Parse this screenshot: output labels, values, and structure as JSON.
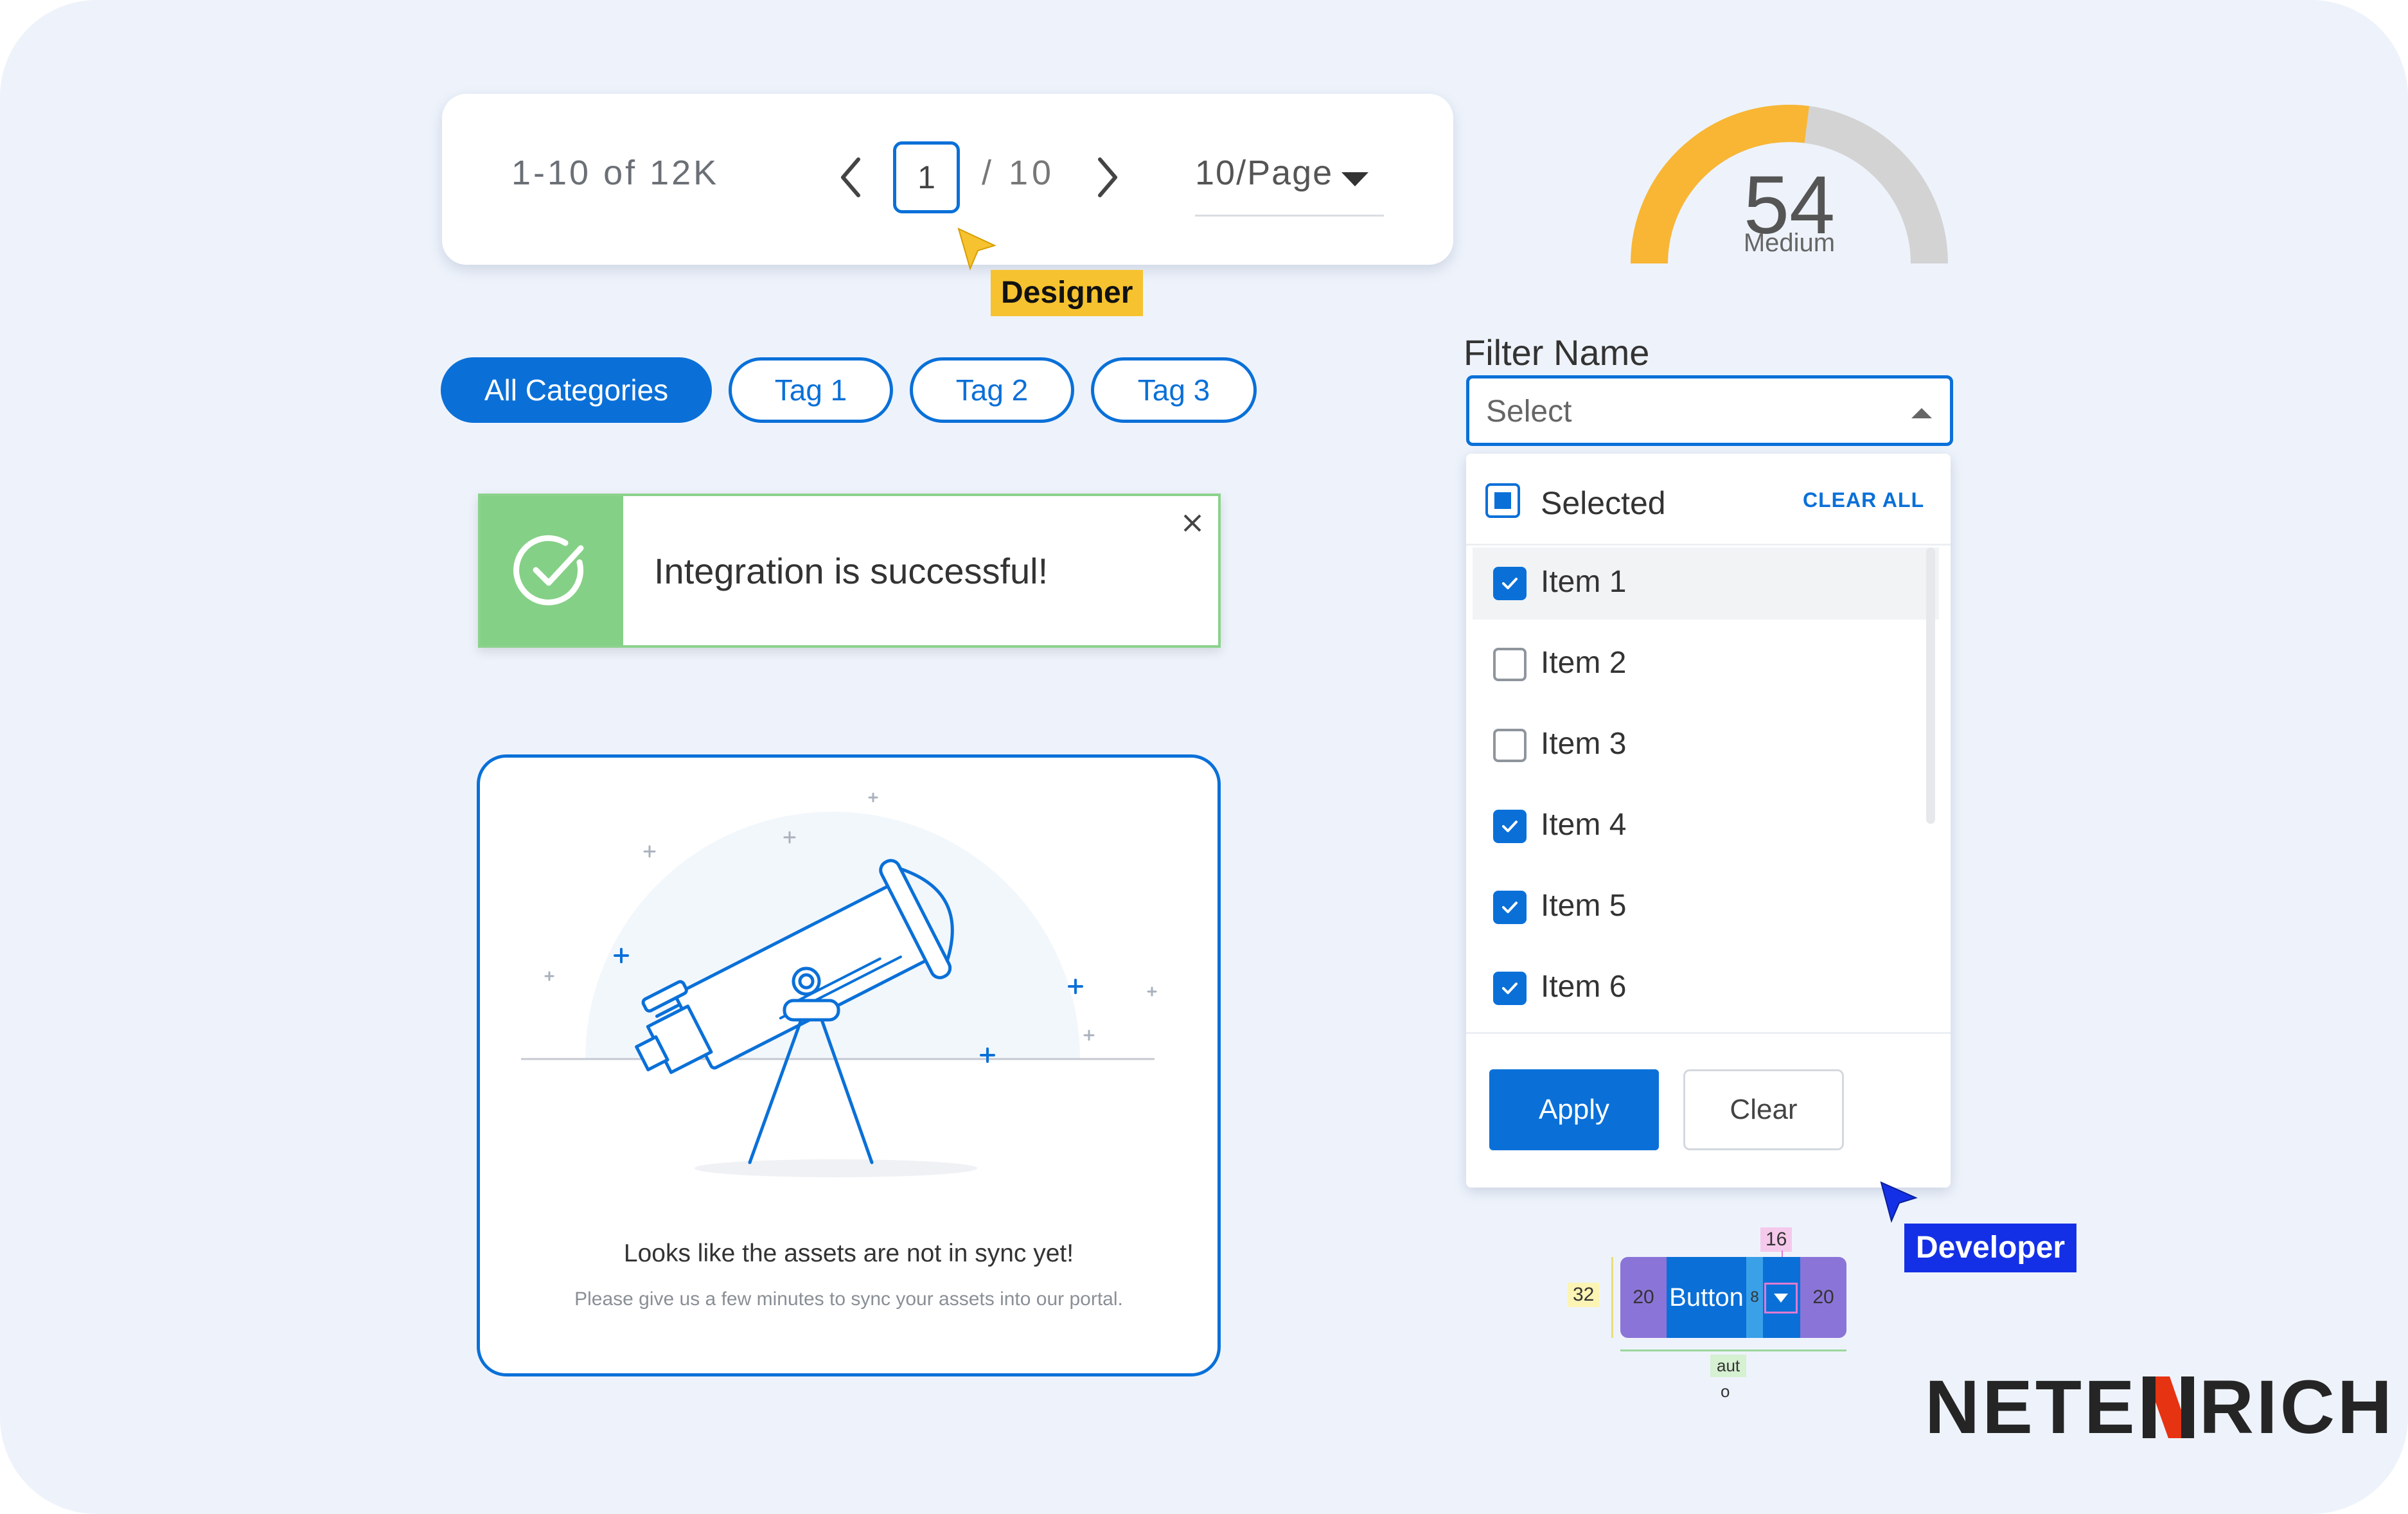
{
  "pagination": {
    "range": "1-10 of 12K",
    "current_page": "1",
    "total_pages": "/ 10",
    "per_page": "10/Page"
  },
  "cursors": {
    "designer_label": "Designer",
    "developer_label": "Developer",
    "designer_color": "#f6c22f",
    "developer_color": "#1430e6"
  },
  "chips": [
    {
      "label": "All Categories",
      "active": true
    },
    {
      "label": "Tag 1",
      "active": false
    },
    {
      "label": "Tag 2",
      "active": false
    },
    {
      "label": "Tag 3",
      "active": false
    }
  ],
  "toast": {
    "message": "Integration is successful!",
    "accent": "#85d087"
  },
  "empty_state": {
    "title": "Looks like the assets are not in sync yet!",
    "subtitle": "Please give us a few minutes to sync your assets into our portal."
  },
  "gauge": {
    "value": "54",
    "label": "Medium",
    "fraction": 0.54,
    "fill_color": "#f8b634",
    "track_color": "#d3d3d3"
  },
  "filter": {
    "label": "Filter Name",
    "placeholder": "Select",
    "selected_label": "Selected",
    "clear_all": "CLEAR ALL",
    "items": [
      {
        "label": "Item 1",
        "checked": true
      },
      {
        "label": "Item 2",
        "checked": false
      },
      {
        "label": "Item 3",
        "checked": false
      },
      {
        "label": "Item 4",
        "checked": true
      },
      {
        "label": "Item 5",
        "checked": true
      },
      {
        "label": "Item 6",
        "checked": true
      }
    ],
    "apply": "Apply",
    "clear": "Clear"
  },
  "button_spec": {
    "label": "Button",
    "height": "32",
    "padding_left": "20",
    "padding_right": "20",
    "gap": "8",
    "icon_size": "16",
    "width_line1": "aut",
    "width_line2": "o"
  },
  "brand": {
    "name_part1": "NETE",
    "name_part2": "RICH",
    "accent": "#e63312"
  },
  "primary_color": "#0a70d8"
}
